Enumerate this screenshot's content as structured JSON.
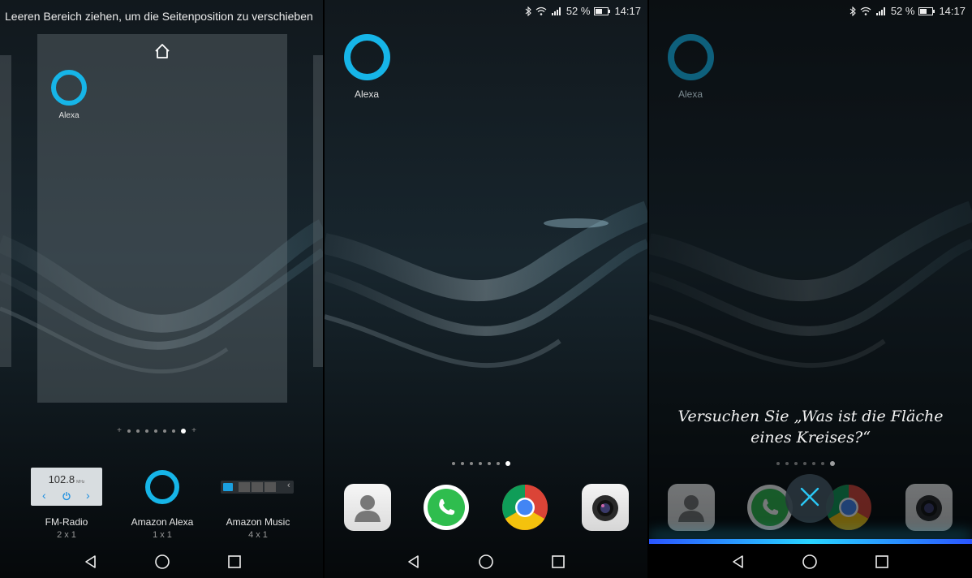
{
  "status": {
    "battery": "52 %",
    "time": "14:17"
  },
  "edit_screen": {
    "hint": "Leeren Bereich ziehen, um die Seitenposition zu verschieben",
    "preview_app_label": "Alexa",
    "page_count": 8,
    "active_page": 7,
    "widgets": [
      {
        "label": "FM-Radio",
        "size": "2 x 1",
        "frequency": "102.8",
        "unit": "MHz"
      },
      {
        "label": "Amazon Alexa",
        "size": "1 x 1"
      },
      {
        "label": "Amazon Music",
        "size": "4 x 1"
      }
    ]
  },
  "home": {
    "app_label": "Alexa",
    "page_count": 7,
    "active_page": 6,
    "dock": [
      "contacts-app",
      "whatsapp-app",
      "chrome-app",
      "camera-app"
    ]
  },
  "alexa_overlay": {
    "app_label": "Alexa",
    "prompt": "Versuchen Sie „Was ist die Fläche eines Kreises?“",
    "close_icon": "close-icon"
  },
  "colors": {
    "alexa": "#16b5e8",
    "accent_bar": "#28d4ff"
  }
}
